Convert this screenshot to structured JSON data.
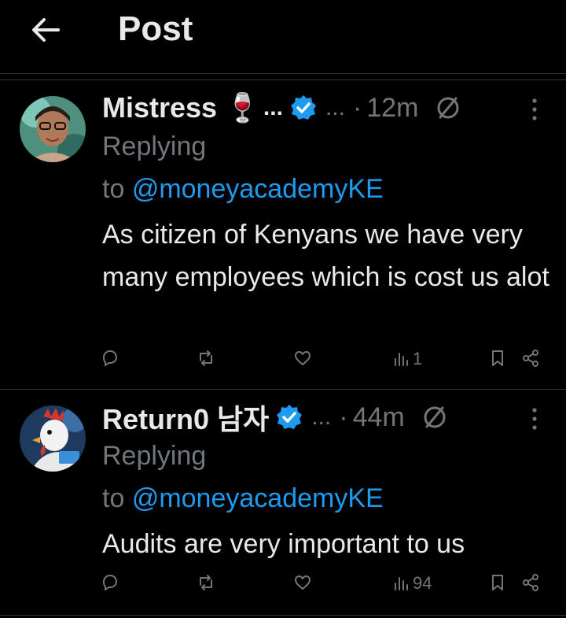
{
  "header": {
    "title": "Post"
  },
  "posts": [
    {
      "name": "Mistress 🍷",
      "name_ellipsis": "...",
      "handle_ellipsis": "...",
      "dot": "·",
      "time": "12m",
      "replying_label": "Replying",
      "to_label": "to ",
      "mention": "@moneyacademyKE",
      "text": "As citizen of Kenyans we have very many employees which is cost us alot",
      "views": "1"
    },
    {
      "name": "Return0 남자",
      "handle_ellipsis": "...",
      "dot": "·",
      "time": "44m",
      "replying_label": "Replying",
      "to_label": "to ",
      "mention": "@moneyacademyKE",
      "text": "Audits are very important to us",
      "views": "94"
    }
  ],
  "colors": {
    "background": "#000000",
    "text": "#e7e9ea",
    "muted": "#71767b",
    "accent": "#1d9bf0",
    "divider": "#2f3336"
  },
  "icons": [
    "back-arrow-icon",
    "verified-badge-icon",
    "no-symbol-icon",
    "more-vertical-icon",
    "reply-icon",
    "repost-icon",
    "like-icon",
    "views-icon",
    "bookmark-icon",
    "share-icon"
  ]
}
